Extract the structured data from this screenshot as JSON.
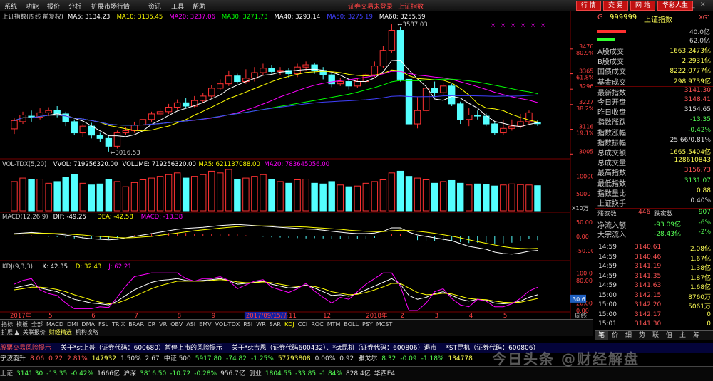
{
  "menubar": {
    "items": [
      "系统",
      "功能",
      "报价",
      "分析",
      "扩展市场行情",
      "资讯",
      "工具",
      "帮助"
    ],
    "notice": "证券交易未登录",
    "index_name": "上证指数",
    "right_buttons": [
      "行 情",
      "交 易",
      "网 站",
      "华彩人生"
    ]
  },
  "chart": {
    "main_header": {
      "title": "上证指数(周线 前复权)",
      "mas": [
        {
          "label": "MA5: 3134.23",
          "color": "#ffffff"
        },
        {
          "label": "MA10: 3135.45",
          "color": "#ffff00"
        },
        {
          "label": "MA20: 3237.06",
          "color": "#ff00ff"
        },
        {
          "label": "MA30: 3271.73",
          "color": "#00ff00"
        },
        {
          "label": "MA40: 3293.14",
          "color": "#ffffff"
        },
        {
          "label": "MA50: 3275.19",
          "color": "#4040ff"
        },
        {
          "label": "MA60: 3255.59",
          "color": "#ffffff"
        }
      ]
    },
    "high_label": "3587.03",
    "low_label": "3016.53",
    "y_ticks": [
      {
        "price": 3476,
        "text": "3476",
        "pct": "80.9%"
      },
      {
        "price": 3365,
        "text": "3365",
        "pct": "61.8%"
      },
      {
        "price": 3296,
        "text": "3296",
        "pct": ""
      },
      {
        "price": 3227,
        "text": "3227",
        "pct": "38.2%"
      },
      {
        "price": 3116,
        "text": "3116",
        "pct": "19.1%"
      },
      {
        "price": 3005,
        "text": "3005",
        "pct": ""
      }
    ],
    "vol_header": [
      {
        "label": "VOL-TDX(5,20)",
        "color": "#cccccc"
      },
      {
        "label": "VVOL: 719256320.00",
        "color": "#ffffff"
      },
      {
        "label": "VOLUME: 719256320.00",
        "color": "#ffffff"
      },
      {
        "label": "MA5: 621137088.00",
        "color": "#ffff00"
      },
      {
        "label": "MA20: 783645056.00",
        "color": "#ff00ff"
      }
    ],
    "vol_ticks": [
      "10000",
      "5000"
    ],
    "vol_unit": "X10万",
    "macd_header": [
      {
        "label": "MACD(12,26,9)",
        "color": "#cccccc"
      },
      {
        "label": "DIF: -49.25",
        "color": "#ffffff"
      },
      {
        "label": "DEA: -42.58",
        "color": "#ffff00"
      },
      {
        "label": "MACD: -13.38",
        "color": "#ff00ff"
      }
    ],
    "macd_ticks": [
      "50.00",
      "0.00",
      "-50.00"
    ],
    "kdj_header": [
      {
        "label": "KDJ(9,3,3)",
        "color": "#cccccc"
      },
      {
        "label": "K: 42.35",
        "color": "#ffffff"
      },
      {
        "label": "D: 32.43",
        "color": "#ffff00"
      },
      {
        "label": "J: 62.21",
        "color": "#ff00ff"
      }
    ],
    "kdj_ticks": [
      "100.00",
      "80.00",
      "20.00",
      "0.00"
    ],
    "kdj_current": "30.6",
    "x_labels": [
      "2017年",
      "5",
      "6",
      "7",
      "8",
      "9",
      "2017/09/15/五",
      "11",
      "12",
      "2018年",
      "2",
      "3",
      "4",
      "5"
    ],
    "period_label": "周线"
  },
  "panel": {
    "code": "999999",
    "name": "上证指数",
    "tag": "XG1",
    "ratios": [
      "40.0亿",
      "62.0亿"
    ],
    "rows": [
      {
        "label": "A股成交",
        "value": "1663.2473亿",
        "color": "#ffff55"
      },
      {
        "label": "B股成交",
        "value": "2.2931亿",
        "color": "#ffff55"
      },
      {
        "label": "国债成交",
        "value": "8222.0777亿",
        "color": "#ffff55"
      },
      {
        "label": "基金成交",
        "value": "298.9739亿",
        "color": "#ffff55"
      },
      {
        "label": "最新指数",
        "value": "3141.30",
        "color": "#ff5555"
      },
      {
        "label": "今日开盘",
        "value": "3148.41",
        "color": "#ff5555"
      },
      {
        "label": "昨日收盘",
        "value": "3154.65",
        "color": "#dddddd"
      },
      {
        "label": "指数涨跌",
        "value": "-13.35",
        "color": "#55ff55"
      },
      {
        "label": "指数涨幅",
        "value": "-0.42%",
        "color": "#55ff55"
      },
      {
        "label": "指数振幅",
        "value": "25.66/0.81%",
        "color": "#dddddd"
      },
      {
        "label": "总成交额",
        "value": "1665.5404亿",
        "color": "#ffff55"
      },
      {
        "label": "总成交量",
        "value": "128610843",
        "color": "#ffff55"
      },
      {
        "label": "最高指数",
        "value": "3156.73",
        "color": "#ff5555"
      },
      {
        "label": "最低指数",
        "value": "3131.07",
        "color": "#55ff55"
      },
      {
        "label": "指数量比",
        "value": "0.88",
        "color": "#ffff55"
      },
      {
        "label": "上证换手",
        "value": "0.40%",
        "color": "#dddddd"
      }
    ],
    "updown": {
      "up_label": "涨家数",
      "up": "446",
      "down_label": "跌家数",
      "down": "907"
    },
    "flows": [
      {
        "label": "净流入额",
        "value": "-93.09亿",
        "pct": "-6%"
      },
      {
        "label": "大宗流入",
        "value": "-28.43亿",
        "pct": "-2%"
      }
    ],
    "ticks": [
      {
        "time": "14:59",
        "price": "3140.61",
        "vol": "2.08亿"
      },
      {
        "time": "14:59",
        "price": "3140.46",
        "vol": "1.67亿"
      },
      {
        "time": "14:59",
        "price": "3141.19",
        "vol": "1.38亿"
      },
      {
        "time": "14:59",
        "price": "3141.35",
        "vol": "1.87亿"
      },
      {
        "time": "14:59",
        "price": "3141.63",
        "vol": "1.68亿"
      },
      {
        "time": "15:00",
        "price": "3142.15",
        "vol": "8760万"
      },
      {
        "time": "15:00",
        "price": "3142.20",
        "vol": "5061万"
      },
      {
        "time": "15:00",
        "price": "3142.17",
        "vol": "0"
      },
      {
        "time": "15:01",
        "price": "3141.30",
        "vol": "0"
      }
    ],
    "tabs": [
      "笔",
      "价",
      "细",
      "势",
      "联",
      "值",
      "主",
      "筹"
    ]
  },
  "tabs": {
    "row1": [
      "指标",
      "模板",
      "全部",
      "MACD",
      "DMI",
      "DMA",
      "FSL",
      "TRIX",
      "BRAR",
      "CR",
      "VR",
      "OBV",
      "ASI",
      "EMV",
      "VOL-TDX",
      "RSI",
      "WR",
      "SAR",
      "KDJ",
      "CCI",
      "ROC",
      "MTM",
      "BOLL",
      "PSY",
      "MCST"
    ],
    "row1_active": 18,
    "row2": [
      "扩展 ▲",
      "关联报价",
      "财经精选",
      "机构攻略"
    ]
  },
  "news": [
    "股票交易风险提示",
    "关于*st上普（证券代码：600680）暂停上市的风险提示",
    "关于*st吉恩（证券代码600432）、*st昆机（证券代码：600806）退市",
    "*ST昆机（证券代码：600806）"
  ],
  "quotes": [
    {
      "text": "宁波韵升",
      "color": "#dddddd"
    },
    {
      "text": "8.06",
      "color": "#ff5555"
    },
    {
      "text": "0.22",
      "color": "#ff5555"
    },
    {
      "text": "2.81%",
      "color": "#ff5555"
    },
    {
      "text": "147932",
      "color": "#ffff55"
    },
    {
      "text": "1.50%",
      "color": "#dddddd"
    },
    {
      "text": "2.67",
      "color": "#dddddd"
    },
    {
      "text": "中证 500",
      "color": "#dddddd"
    },
    {
      "text": "5917.80",
      "color": "#55ff55"
    },
    {
      "text": "-74.82",
      "color": "#55ff55"
    },
    {
      "text": "-1.25%",
      "color": "#55ff55"
    },
    {
      "text": "57793808",
      "color": "#ffff55"
    },
    {
      "text": "0.00%",
      "color": "#dddddd"
    },
    {
      "text": "0.92",
      "color": "#dddddd"
    },
    {
      "text": "雅戈尔",
      "color": "#dddddd"
    },
    {
      "text": "8.32",
      "color": "#55ff55"
    },
    {
      "text": "-0.09",
      "color": "#55ff55"
    },
    {
      "text": "-1.18%",
      "color": "#55ff55"
    },
    {
      "text": "134778",
      "color": "#ffff55"
    }
  ],
  "status": [
    {
      "text": "上证",
      "color": "#dddddd"
    },
    {
      "text": "3141.30",
      "color": "#55ff55"
    },
    {
      "text": "-13.35",
      "color": "#55ff55"
    },
    {
      "text": "-0.42%",
      "color": "#55ff55"
    },
    {
      "text": "1666亿",
      "color": "#dddddd"
    },
    {
      "text": "沪深",
      "color": "#dddddd"
    },
    {
      "text": "3816.50",
      "color": "#55ff55"
    },
    {
      "text": "-10.72",
      "color": "#55ff55"
    },
    {
      "text": "-0.28%",
      "color": "#55ff55"
    },
    {
      "text": "956.7亿",
      "color": "#dddddd"
    },
    {
      "text": "创业",
      "color": "#dddddd"
    },
    {
      "text": "1804.55",
      "color": "#55ff55"
    },
    {
      "text": "-33.85",
      "color": "#55ff55"
    },
    {
      "text": "-1.84%",
      "color": "#55ff55"
    },
    {
      "text": "828.4亿",
      "color": "#dddddd"
    },
    {
      "text": "华西E4",
      "color": "#dddddd"
    }
  ],
  "watermark": "今日头条 @财经解盘",
  "chart_data": {
    "type": "candlestick",
    "period": "weekly",
    "ylim": [
      2990,
      3600
    ],
    "candles": [
      [
        3118,
        3155,
        3095,
        3165
      ],
      [
        3150,
        3180,
        3140,
        3195
      ],
      [
        3175,
        3170,
        3150,
        3200
      ],
      [
        3170,
        3190,
        3160,
        3210
      ],
      [
        3190,
        3200,
        3175,
        3215
      ],
      [
        3200,
        3185,
        3170,
        3220
      ],
      [
        3185,
        3150,
        3130,
        3195
      ],
      [
        3150,
        3100,
        3090,
        3160
      ],
      [
        3100,
        3130,
        3080,
        3140
      ],
      [
        3130,
        3090,
        3075,
        3145
      ],
      [
        3090,
        3075,
        3060,
        3100
      ],
      [
        3075,
        3040,
        3016,
        3085
      ],
      [
        3040,
        3100,
        3030,
        3110
      ],
      [
        3100,
        3110,
        3090,
        3125
      ],
      [
        3110,
        3135,
        3100,
        3150
      ],
      [
        3135,
        3160,
        3125,
        3175
      ],
      [
        3160,
        3185,
        3150,
        3195
      ],
      [
        3185,
        3195,
        3170,
        3210
      ],
      [
        3195,
        3215,
        3185,
        3230
      ],
      [
        3215,
        3235,
        3205,
        3250
      ],
      [
        3235,
        3220,
        3210,
        3255
      ],
      [
        3220,
        3245,
        3215,
        3265
      ],
      [
        3245,
        3265,
        3235,
        3280
      ],
      [
        3265,
        3300,
        3255,
        3315
      ],
      [
        3300,
        3320,
        3290,
        3340
      ],
      [
        3320,
        3355,
        3310,
        3380
      ],
      [
        3355,
        3330,
        3320,
        3365
      ],
      [
        3330,
        3345,
        3320,
        3385
      ],
      [
        3345,
        3370,
        3330,
        3395
      ],
      [
        3370,
        3390,
        3360,
        3410
      ],
      [
        3390,
        3375,
        3365,
        3405
      ],
      [
        3375,
        3380,
        3360,
        3395
      ],
      [
        3380,
        3365,
        3345,
        3390
      ],
      [
        3365,
        3395,
        3350,
        3410
      ],
      [
        3395,
        3405,
        3380,
        3420
      ],
      [
        3405,
        3380,
        3365,
        3415
      ],
      [
        3380,
        3360,
        3340,
        3395
      ],
      [
        3360,
        3320,
        3305,
        3370
      ],
      [
        3320,
        3330,
        3310,
        3345
      ],
      [
        3330,
        3310,
        3295,
        3345
      ],
      [
        3310,
        3330,
        3300,
        3345
      ],
      [
        3330,
        3360,
        3320,
        3370
      ],
      [
        3360,
        3400,
        3350,
        3420
      ],
      [
        3400,
        3470,
        3390,
        3490
      ],
      [
        3470,
        3560,
        3460,
        3587
      ],
      [
        3560,
        3340,
        3330,
        3575
      ],
      [
        3340,
        3140,
        3110,
        3360
      ],
      [
        3140,
        3200,
        3120,
        3260
      ],
      [
        3200,
        3300,
        3190,
        3320
      ],
      [
        3300,
        3280,
        3260,
        3330
      ],
      [
        3280,
        3310,
        3270,
        3325
      ],
      [
        3310,
        3230,
        3220,
        3320
      ],
      [
        3230,
        3160,
        3140,
        3240
      ],
      [
        3160,
        3180,
        3130,
        3210
      ],
      [
        3180,
        3175,
        3160,
        3200
      ],
      [
        3175,
        3140,
        3130,
        3190
      ],
      [
        3140,
        3100,
        3090,
        3150
      ],
      [
        3100,
        3120,
        3090,
        3160
      ],
      [
        3120,
        3130,
        3110,
        3160
      ],
      [
        3130,
        3150,
        3120,
        3185
      ],
      [
        3150,
        3190,
        3140,
        3200
      ],
      [
        3148,
        3141,
        3131,
        3157
      ]
    ],
    "volume_max": 12000,
    "volume": [
      8500,
      9500,
      9000,
      9200,
      8000,
      8500,
      9800,
      10500,
      8000,
      7500,
      7800,
      9000,
      8500,
      7000,
      8200,
      9000,
      9500,
      10000,
      10500,
      11000,
      9500,
      10000,
      10500,
      11500,
      11000,
      12000,
      9000,
      9500,
      10000,
      10500,
      9000,
      8500,
      8000,
      9000,
      9200,
      8000,
      7800,
      8500,
      7500,
      7000,
      7200,
      8000,
      8500,
      9000,
      11000,
      11500,
      10000,
      9500,
      9000,
      8000,
      8500,
      8800,
      8000,
      7500,
      7800,
      7600,
      7200,
      7500,
      7800,
      7600,
      7500,
      7300
    ],
    "macd": {
      "ylim": [
        -80,
        60
      ],
      "dif": [
        10,
        12,
        14,
        12,
        10,
        8,
        5,
        0,
        -5,
        -8,
        -10,
        -12,
        -10,
        -5,
        0,
        5,
        10,
        15,
        20,
        25,
        28,
        30,
        32,
        35,
        38,
        40,
        42,
        40,
        38,
        36,
        34,
        32,
        30,
        28,
        26,
        25,
        22,
        18,
        15,
        12,
        10,
        10,
        12,
        18,
        30,
        30,
        15,
        5,
        0,
        -5,
        -10,
        -15,
        -25,
        -35,
        -40,
        -45,
        -55,
        -60,
        -62,
        -58,
        -52,
        -49
      ],
      "dea": [
        8,
        9,
        10,
        11,
        11,
        10,
        9,
        7,
        5,
        2,
        0,
        -2,
        -4,
        -5,
        -4,
        -2,
        0,
        4,
        8,
        12,
        16,
        20,
        23,
        26,
        29,
        32,
        34,
        36,
        37,
        37,
        37,
        36,
        35,
        34,
        33,
        31,
        29,
        27,
        25,
        22,
        20,
        18,
        17,
        17,
        20,
        22,
        21,
        18,
        15,
        11,
        6,
        1,
        -5,
        -12,
        -18,
        -24,
        -30,
        -36,
        -40,
        -42,
        -43,
        -42
      ],
      "hist": [
        2,
        3,
        4,
        1,
        -1,
        -2,
        -4,
        -7,
        -10,
        -10,
        -10,
        -10,
        -6,
        0,
        4,
        7,
        10,
        11,
        12,
        13,
        12,
        10,
        9,
        9,
        9,
        8,
        8,
        4,
        1,
        -1,
        -3,
        -4,
        -5,
        -6,
        -7,
        -6,
        -7,
        -9,
        -10,
        -10,
        -10,
        -8,
        -5,
        1,
        10,
        8,
        -6,
        -13,
        -15,
        -16,
        -16,
        -16,
        -20,
        -23,
        -22,
        -21,
        -25,
        -24,
        -22,
        -16,
        -9,
        -13
      ]
    },
    "kdj": {
      "ylim": [
        0,
        110
      ],
      "k": [
        60,
        65,
        70,
        60,
        55,
        50,
        40,
        30,
        25,
        20,
        18,
        15,
        25,
        40,
        55,
        65,
        75,
        80,
        82,
        85,
        80,
        78,
        80,
        82,
        85,
        80,
        70,
        72,
        75,
        78,
        70,
        65,
        60,
        62,
        68,
        60,
        50,
        40,
        42,
        38,
        45,
        55,
        65,
        75,
        85,
        70,
        40,
        30,
        35,
        45,
        50,
        40,
        30,
        25,
        30,
        28,
        20,
        18,
        20,
        25,
        35,
        42
      ],
      "d": [
        55,
        58,
        62,
        62,
        60,
        56,
        50,
        42,
        35,
        28,
        22,
        18,
        20,
        28,
        38,
        48,
        58,
        66,
        72,
        78,
        78,
        78,
        78,
        80,
        82,
        80,
        76,
        74,
        74,
        76,
        74,
        70,
        66,
        64,
        66,
        64,
        58,
        50,
        46,
        42,
        43,
        48,
        55,
        63,
        72,
        72,
        60,
        48,
        42,
        43,
        46,
        44,
        38,
        32,
        30,
        29,
        25,
        22,
        21,
        22,
        27,
        32
      ],
      "j": [
        70,
        80,
        85,
        55,
        45,
        40,
        20,
        5,
        5,
        5,
        10,
        8,
        35,
        65,
        90,
        95,
        100,
        100,
        100,
        100,
        85,
        78,
        85,
        85,
        90,
        80,
        58,
        68,
        78,
        82,
        62,
        55,
        48,
        58,
        72,
        52,
        35,
        20,
        35,
        30,
        50,
        70,
        85,
        100,
        100,
        65,
        0,
        0,
        20,
        50,
        58,
        32,
        15,
        10,
        30,
        25,
        10,
        10,
        18,
        32,
        52,
        62
      ]
    }
  }
}
